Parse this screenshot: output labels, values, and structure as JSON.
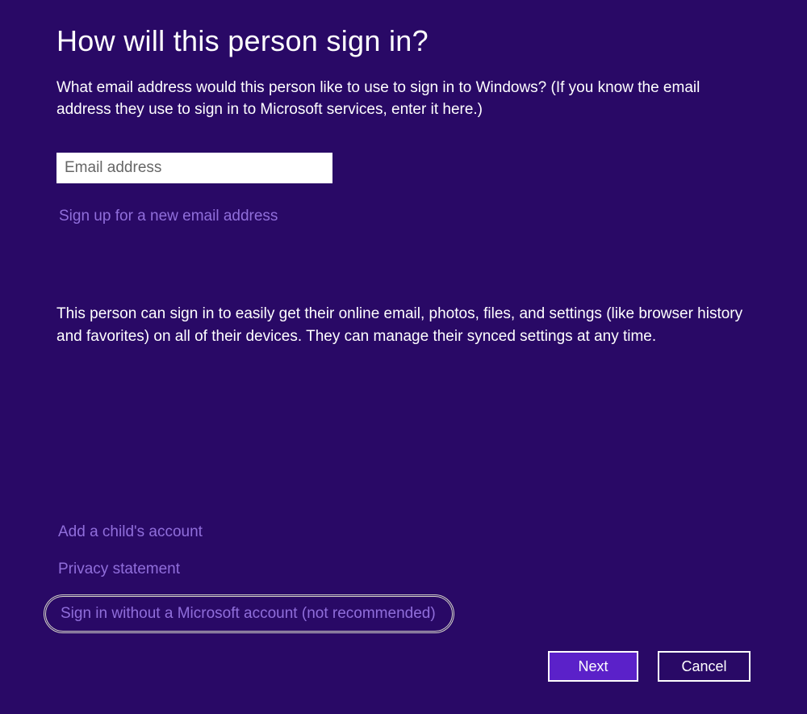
{
  "header": {
    "title": "How will this person sign in?"
  },
  "main": {
    "description": "What email address would this person like to use to sign in to Windows? (If you know the email address they use to sign in to Microsoft services, enter it here.)",
    "email_placeholder": "Email address",
    "email_value": "",
    "signup_link": "Sign up for a new email address",
    "info_text": "This person can sign in to easily get their online email, photos, files, and settings (like browser history and favorites) on all of their devices. They can manage their synced settings at any time."
  },
  "footer": {
    "links": {
      "add_child": "Add a child's account",
      "privacy": "Privacy statement",
      "no_account": "Sign in without a Microsoft account (not recommended)"
    },
    "buttons": {
      "next": "Next",
      "cancel": "Cancel"
    }
  },
  "colors": {
    "background": "#290966",
    "text": "#ffffff",
    "link": "#906edb",
    "primaryButton": "#5b21c9",
    "highlight": "#d4d4c8"
  }
}
